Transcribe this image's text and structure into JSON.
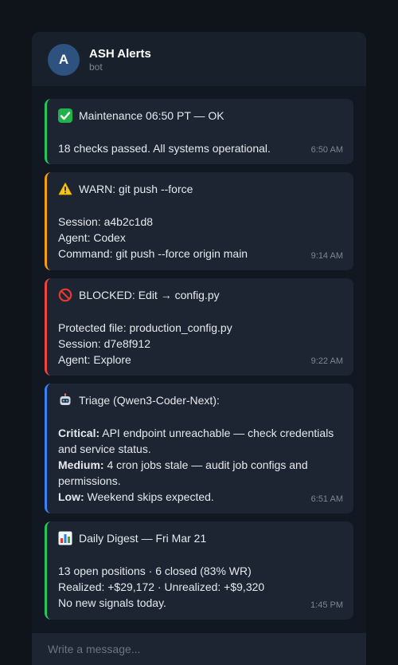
{
  "header": {
    "avatar_letter": "A",
    "name": "ASH Alerts",
    "subtitle": "bot"
  },
  "colors": {
    "ok": "#22c55e",
    "warn": "#f59e0b",
    "blocked": "#ef4444",
    "triage": "#3b82f6",
    "digest": "#22c55e"
  },
  "messages": [
    {
      "icon": "check-mark-icon",
      "title": "Maintenance 06:50 PT — OK",
      "lines": [
        "18 checks passed. All systems operational."
      ],
      "time": "6:50 AM"
    },
    {
      "icon": "warning-icon",
      "title": "WARN: git push --force",
      "lines": [
        "Session: a4b2c1d8",
        "Agent: Codex",
        "Command: git push --force origin main"
      ],
      "time": "9:14 AM"
    },
    {
      "icon": "prohibited-icon",
      "title": "BLOCKED: Edit → config.py",
      "lines": [
        "Protected file: production_config.py",
        "Session: d7e8f912",
        "Agent: Explore"
      ],
      "time": "9:22 AM"
    },
    {
      "icon": "robot-icon",
      "title": "Triage (Qwen3-Coder-Next):",
      "items": [
        {
          "label": "Critical:",
          "text": " API endpoint unreachable — check credentials and service status."
        },
        {
          "label": "Medium:",
          "text": " 4 cron jobs stale — audit job configs and permissions."
        },
        {
          "label": "Low:",
          "text": " Weekend skips expected."
        }
      ],
      "time": "6:51 AM"
    },
    {
      "icon": "bar-chart-icon",
      "title": "Daily Digest — Fri Mar 21",
      "lines": [
        "13 open positions · 6 closed (83% WR)",
        "Realized: +$29,172 · Unrealized: +$9,320",
        "No new signals today."
      ],
      "time": "1:45 PM"
    }
  ],
  "composer": {
    "placeholder": "Write a message..."
  }
}
